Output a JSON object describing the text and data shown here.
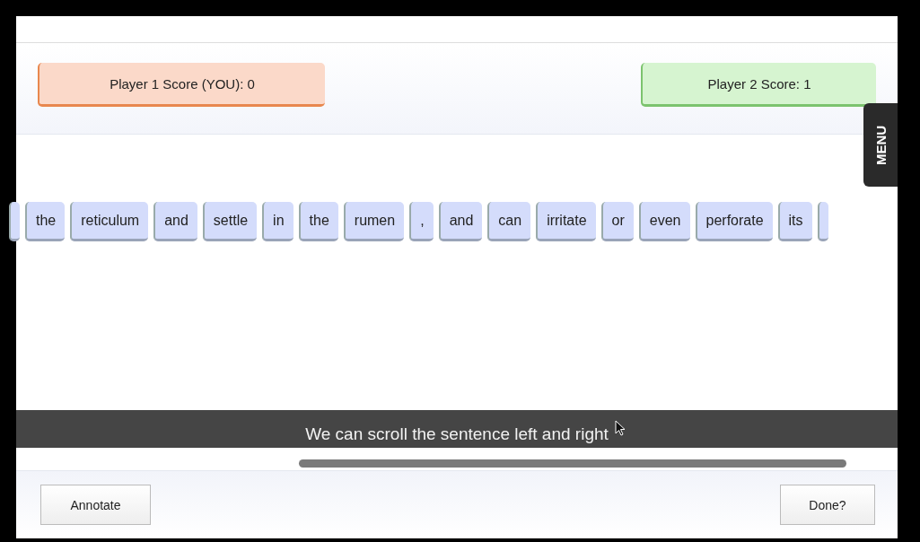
{
  "scores": [
    {
      "label": "Player 1 Score (YOU): 0",
      "kind": "self"
    },
    {
      "label": "Player 2 Score: 1",
      "kind": "opponent"
    }
  ],
  "menu": {
    "label": "MENU"
  },
  "sentence": {
    "words": [
      "the",
      "reticulum",
      "and",
      "settle",
      "in",
      "the",
      "rumen",
      ",",
      "and",
      "can",
      "irritate",
      "or",
      "even",
      "perforate",
      "its"
    ]
  },
  "caption": "We can scroll the sentence left and right",
  "buttons": {
    "left": "Annotate",
    "right": "Done?"
  }
}
